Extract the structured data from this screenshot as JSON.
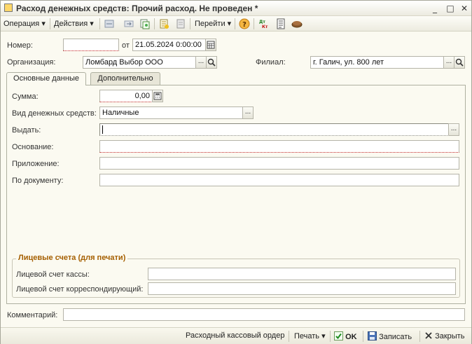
{
  "window": {
    "title": "Расход денежных средств: Прочий расход. Не проведен *",
    "minimize": "_",
    "maximize": "□",
    "close": "✕"
  },
  "toolbar": {
    "operation_label": "Операция ▾",
    "actions_label": "Действия ▾",
    "goto_label": "Перейти ▾",
    "help_glyph": "?",
    "dt_kt_glyph": "Дт\nКт"
  },
  "header": {
    "number_label": "Номер:",
    "number_value": "",
    "date_label": "от",
    "date_value": "21.05.2024  0:00:00",
    "org_label": "Организация:",
    "org_value": "Ломбард Выбор ООО",
    "branch_label": "Филиал:",
    "branch_value": "г. Галич, ул. 800 лет",
    "ellipsis": "...",
    "search_glyph": "🔍"
  },
  "tabs": [
    {
      "label": "Основные данные"
    },
    {
      "label": "Дополнительно"
    }
  ],
  "main": {
    "sum_label": "Сумма:",
    "sum_value": "0,00",
    "money_type_label": "Вид денежных средств:",
    "money_type_value": "Наличные",
    "issue_label": "Выдать:",
    "issue_value": "",
    "basis_label": "Основание:",
    "basis_value": "",
    "appendix_label": "Приложение:",
    "appendix_value": "",
    "by_doc_label": "По документу:",
    "by_doc_value": ""
  },
  "accounts_group": {
    "title": "Лицевые счета (для печати)",
    "cash_label": "Лицевой счет кассы:",
    "cash_value": "",
    "corr_label": "Лицевой счет корреспондирующий:",
    "corr_value": ""
  },
  "comment": {
    "label": "Комментарий:",
    "value": ""
  },
  "footer": {
    "cash_order_label": "Расходный кассовый ордер",
    "print_label": "Печать ▾",
    "ok_label": "OK",
    "save_label": "Записать",
    "close_label": "Закрыть"
  },
  "colors": {
    "background": "#fbfaf1",
    "group_title": "#a55f00",
    "required_underline": "#c02020"
  }
}
